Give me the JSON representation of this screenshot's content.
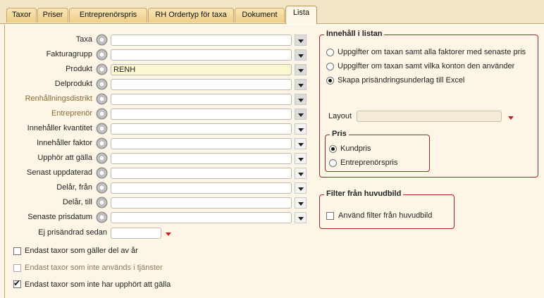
{
  "tabs": [
    "Taxor",
    "Priser",
    "Entreprenörspris",
    "RH Ordertyp för taxa",
    "Dokument",
    "Lista"
  ],
  "fields": [
    {
      "label": "Taxa",
      "value": ""
    },
    {
      "label": "Fakturagrupp",
      "value": ""
    },
    {
      "label": "Produkt",
      "value": "RENH"
    },
    {
      "label": "Delprodukt",
      "value": ""
    },
    {
      "label": "Renhållningsdistrikt",
      "value": ""
    },
    {
      "label": "Entreprenör",
      "value": ""
    },
    {
      "label": "Innehåller kvantitet",
      "value": ""
    },
    {
      "label": "Innehåller faktor",
      "value": ""
    },
    {
      "label": "Upphör att gälla",
      "value": ""
    },
    {
      "label": "Senast uppdaterad",
      "value": ""
    },
    {
      "label": "Delår, från",
      "value": ""
    },
    {
      "label": "Delår, till",
      "value": ""
    },
    {
      "label": "Senaste prisdatum",
      "value": ""
    }
  ],
  "ej_prisandrad": {
    "label": "Ej prisändrad sedan",
    "value": ""
  },
  "checkboxes": [
    {
      "label": "Endast taxor som gäller del av år",
      "checked": false
    },
    {
      "label": "Endast taxor som inte används i tjänster",
      "checked": false,
      "disabled": true
    },
    {
      "label": "Endast taxor som inte har upphört att gälla",
      "checked": true
    }
  ],
  "innehall": {
    "title": "Innehåll i listan",
    "options": [
      {
        "label": "Uppgifter om taxan samt alla faktorer med senaste pris",
        "selected": false
      },
      {
        "label": "Uppgifter om taxan samt vilka konton den använder",
        "selected": false
      },
      {
        "label": "Skapa prisändringsunderlag till Excel",
        "selected": true
      }
    ],
    "layout_label": "Layout",
    "layout_value": ""
  },
  "pris": {
    "title": "Pris",
    "options": [
      {
        "label": "Kundpris",
        "selected": true
      },
      {
        "label": "Entreprenörspris",
        "selected": false
      }
    ]
  },
  "filter": {
    "title": "Filter från huvudbild",
    "checkbox_label": "Använd filter från huvudbild",
    "checked": false
  },
  "check_mark": "✔",
  "accent_colors": {
    "group_border": "#b32222",
    "tab_border": "#c9a56a",
    "label_disabled": "#8b6a34"
  }
}
